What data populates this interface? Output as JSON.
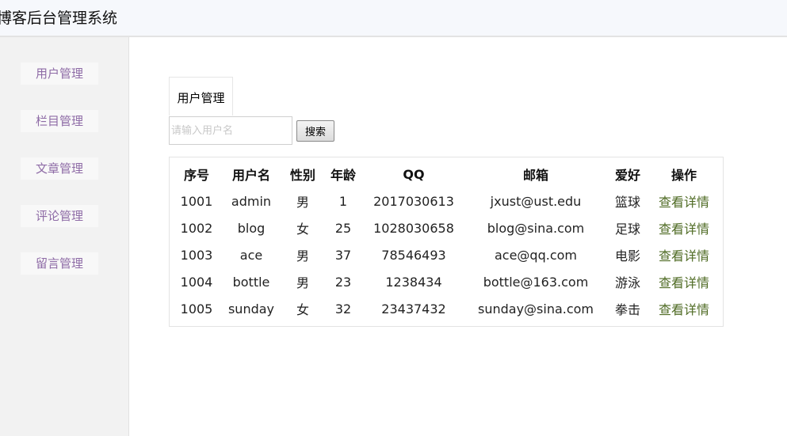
{
  "header": {
    "title": "博客后台管理系统"
  },
  "sidebar": {
    "items": [
      {
        "label": "用户管理"
      },
      {
        "label": "栏目管理"
      },
      {
        "label": "文章管理"
      },
      {
        "label": "评论管理"
      },
      {
        "label": "留言管理"
      }
    ]
  },
  "tab": {
    "label": "用户管理"
  },
  "search": {
    "placeholder": "请输入用户名",
    "button_label": "搜索"
  },
  "table": {
    "headers": [
      "序号",
      "用户名",
      "性别",
      "年龄",
      "QQ",
      "邮箱",
      "爱好",
      "操作"
    ],
    "rows": [
      [
        "1001",
        "admin",
        "男",
        "1",
        "2017030613",
        "jxust@ust.edu",
        "篮球",
        "查看详情"
      ],
      [
        "1002",
        "blog",
        "女",
        "25",
        "1028030658",
        "blog@sina.com",
        "足球",
        "查看详情"
      ],
      [
        "1003",
        "ace",
        "男",
        "37",
        "78546493",
        "ace@qq.com",
        "电影",
        "查看详情"
      ],
      [
        "1004",
        "bottle",
        "男",
        "23",
        "1238434",
        "bottle@163.com",
        "游泳",
        "查看详情"
      ],
      [
        "1005",
        "sunday",
        "女",
        "32",
        "23437432",
        "sunday@sina.com",
        "拳击",
        "查看详情"
      ]
    ]
  },
  "colors": {
    "sidebar_text": "#8e6ba6",
    "link": "#4f6b24"
  }
}
